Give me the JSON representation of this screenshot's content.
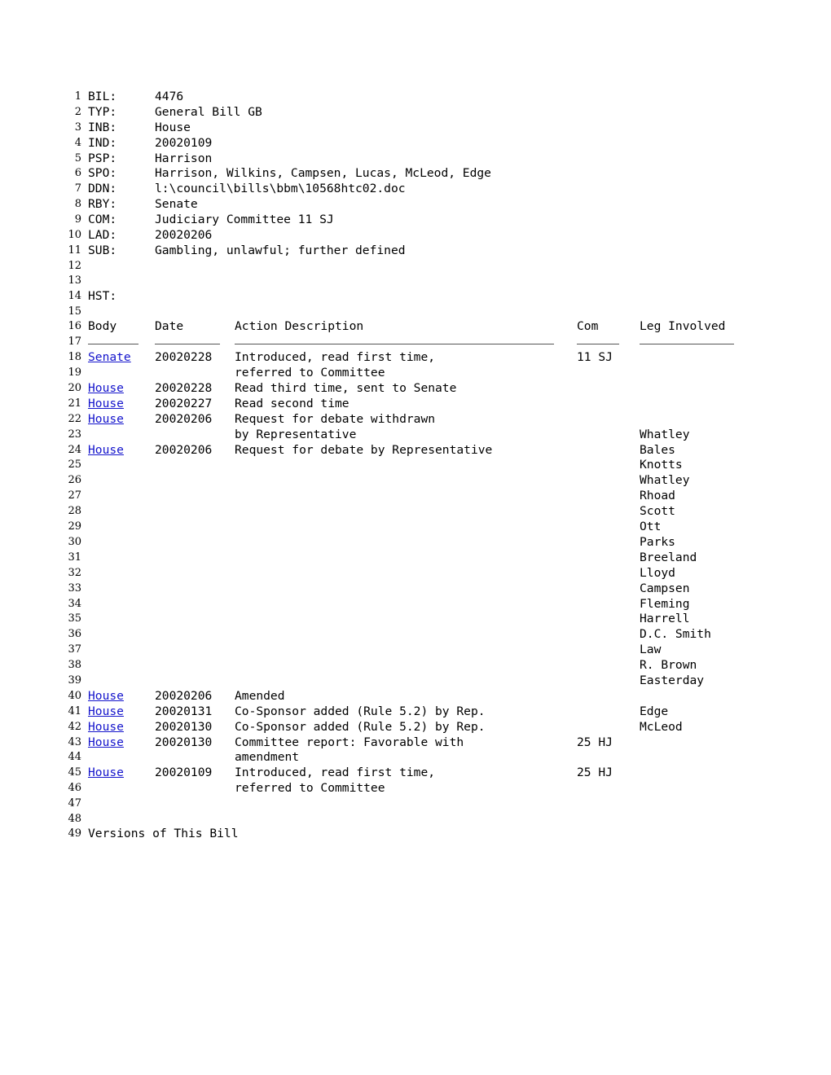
{
  "document": {
    "title": "Bill 4476 Status",
    "link_color": "#1414cc",
    "text_color": "#000000",
    "background_color": "#ffffff"
  },
  "fields": [
    {
      "line": "1",
      "label": "BIL:",
      "value": "4476"
    },
    {
      "line": "2",
      "label": "TYP:",
      "value": "General Bill GB"
    },
    {
      "line": "3",
      "label": "INB:",
      "value": "House"
    },
    {
      "line": "4",
      "label": "IND:",
      "value": "20020109"
    },
    {
      "line": "5",
      "label": "PSP:",
      "value": "Harrison"
    },
    {
      "line": "6",
      "label": "SPO:",
      "value": "Harrison, Wilkins, Campsen, Lucas, McLeod, Edge"
    },
    {
      "line": "7",
      "label": "DDN:",
      "value": "l:\\council\\bills\\bbm\\10568htc02.doc"
    },
    {
      "line": "8",
      "label": "RBY:",
      "value": "Senate"
    },
    {
      "line": "9",
      "label": "COM:",
      "value": "Judiciary Committee 11 SJ"
    },
    {
      "line": "10",
      "label": "LAD:",
      "value": "20020206"
    },
    {
      "line": "11",
      "label": "SUB:",
      "value": "Gambling, unlawful; further defined"
    }
  ],
  "blank_12": {
    "line": "12"
  },
  "blank_13": {
    "line": "13"
  },
  "history_label": {
    "line": "14",
    "text": "HST:"
  },
  "blank_15": {
    "line": "15"
  },
  "history_header": {
    "line": "16",
    "body": "Body",
    "date": "Date",
    "action": "Action Description",
    "com": "Com",
    "leg": "Leg Involved"
  },
  "rule_line": {
    "line": "17"
  },
  "history_rows": [
    {
      "line": "18",
      "body": "Senate",
      "body_is_link": true,
      "date": "20020228",
      "action": "Introduced, read first time,",
      "com": "11 SJ",
      "leg": ""
    },
    {
      "line": "19",
      "body": "",
      "body_is_link": false,
      "date": "",
      "action": "referred to Committee",
      "com": "",
      "leg": ""
    },
    {
      "line": "20",
      "body": "House",
      "body_is_link": true,
      "date": "20020228",
      "action": "Read third time, sent to Senate",
      "com": "",
      "leg": ""
    },
    {
      "line": "21",
      "body": "House",
      "body_is_link": true,
      "date": "20020227",
      "action": "Read second time",
      "com": "",
      "leg": ""
    },
    {
      "line": "22",
      "body": "House",
      "body_is_link": true,
      "date": "20020206",
      "action": "Request for debate withdrawn",
      "com": "",
      "leg": ""
    },
    {
      "line": "23",
      "body": "",
      "body_is_link": false,
      "date": "",
      "action": "by Representative",
      "com": "",
      "leg": "Whatley"
    },
    {
      "line": "24",
      "body": "House",
      "body_is_link": true,
      "date": "20020206",
      "action": "Request for debate by Representative",
      "com": "",
      "leg": "Bales"
    },
    {
      "line": "25",
      "body": "",
      "body_is_link": false,
      "date": "",
      "action": "",
      "com": "",
      "leg": "Knotts"
    },
    {
      "line": "26",
      "body": "",
      "body_is_link": false,
      "date": "",
      "action": "",
      "com": "",
      "leg": "Whatley"
    },
    {
      "line": "27",
      "body": "",
      "body_is_link": false,
      "date": "",
      "action": "",
      "com": "",
      "leg": "Rhoad"
    },
    {
      "line": "28",
      "body": "",
      "body_is_link": false,
      "date": "",
      "action": "",
      "com": "",
      "leg": "Scott"
    },
    {
      "line": "29",
      "body": "",
      "body_is_link": false,
      "date": "",
      "action": "",
      "com": "",
      "leg": "Ott"
    },
    {
      "line": "30",
      "body": "",
      "body_is_link": false,
      "date": "",
      "action": "",
      "com": "",
      "leg": "Parks"
    },
    {
      "line": "31",
      "body": "",
      "body_is_link": false,
      "date": "",
      "action": "",
      "com": "",
      "leg": "Breeland"
    },
    {
      "line": "32",
      "body": "",
      "body_is_link": false,
      "date": "",
      "action": "",
      "com": "",
      "leg": "Lloyd"
    },
    {
      "line": "33",
      "body": "",
      "body_is_link": false,
      "date": "",
      "action": "",
      "com": "",
      "leg": "Campsen"
    },
    {
      "line": "34",
      "body": "",
      "body_is_link": false,
      "date": "",
      "action": "",
      "com": "",
      "leg": "Fleming"
    },
    {
      "line": "35",
      "body": "",
      "body_is_link": false,
      "date": "",
      "action": "",
      "com": "",
      "leg": "Harrell"
    },
    {
      "line": "36",
      "body": "",
      "body_is_link": false,
      "date": "",
      "action": "",
      "com": "",
      "leg": "D.C. Smith"
    },
    {
      "line": "37",
      "body": "",
      "body_is_link": false,
      "date": "",
      "action": "",
      "com": "",
      "leg": "Law"
    },
    {
      "line": "38",
      "body": "",
      "body_is_link": false,
      "date": "",
      "action": "",
      "com": "",
      "leg": "R. Brown"
    },
    {
      "line": "39",
      "body": "",
      "body_is_link": false,
      "date": "",
      "action": "",
      "com": "",
      "leg": "Easterday"
    },
    {
      "line": "40",
      "body": "House",
      "body_is_link": true,
      "date": "20020206",
      "action": "Amended",
      "com": "",
      "leg": ""
    },
    {
      "line": "41",
      "body": "House",
      "body_is_link": true,
      "date": "20020131",
      "action": "Co-Sponsor added (Rule 5.2) by Rep.",
      "com": "",
      "leg": "Edge"
    },
    {
      "line": "42",
      "body": "House",
      "body_is_link": true,
      "date": "20020130",
      "action": "Co-Sponsor added (Rule 5.2) by Rep.",
      "com": "",
      "leg": "McLeod"
    },
    {
      "line": "43",
      "body": "House",
      "body_is_link": true,
      "date": "20020130",
      "action": "Committee report: Favorable with",
      "com": "25 HJ",
      "leg": ""
    },
    {
      "line": "44",
      "body": "",
      "body_is_link": false,
      "date": "",
      "action": "amendment",
      "com": "",
      "leg": ""
    },
    {
      "line": "45",
      "body": "House",
      "body_is_link": true,
      "date": "20020109",
      "action": "Introduced, read first time,",
      "com": "25 HJ",
      "leg": ""
    },
    {
      "line": "46",
      "body": "",
      "body_is_link": false,
      "date": "",
      "action": "referred to Committee",
      "com": "",
      "leg": ""
    }
  ],
  "blank_47": {
    "line": "47"
  },
  "blank_48": {
    "line": "48"
  },
  "versions": {
    "line": "49",
    "text": "Versions of This Bill"
  }
}
